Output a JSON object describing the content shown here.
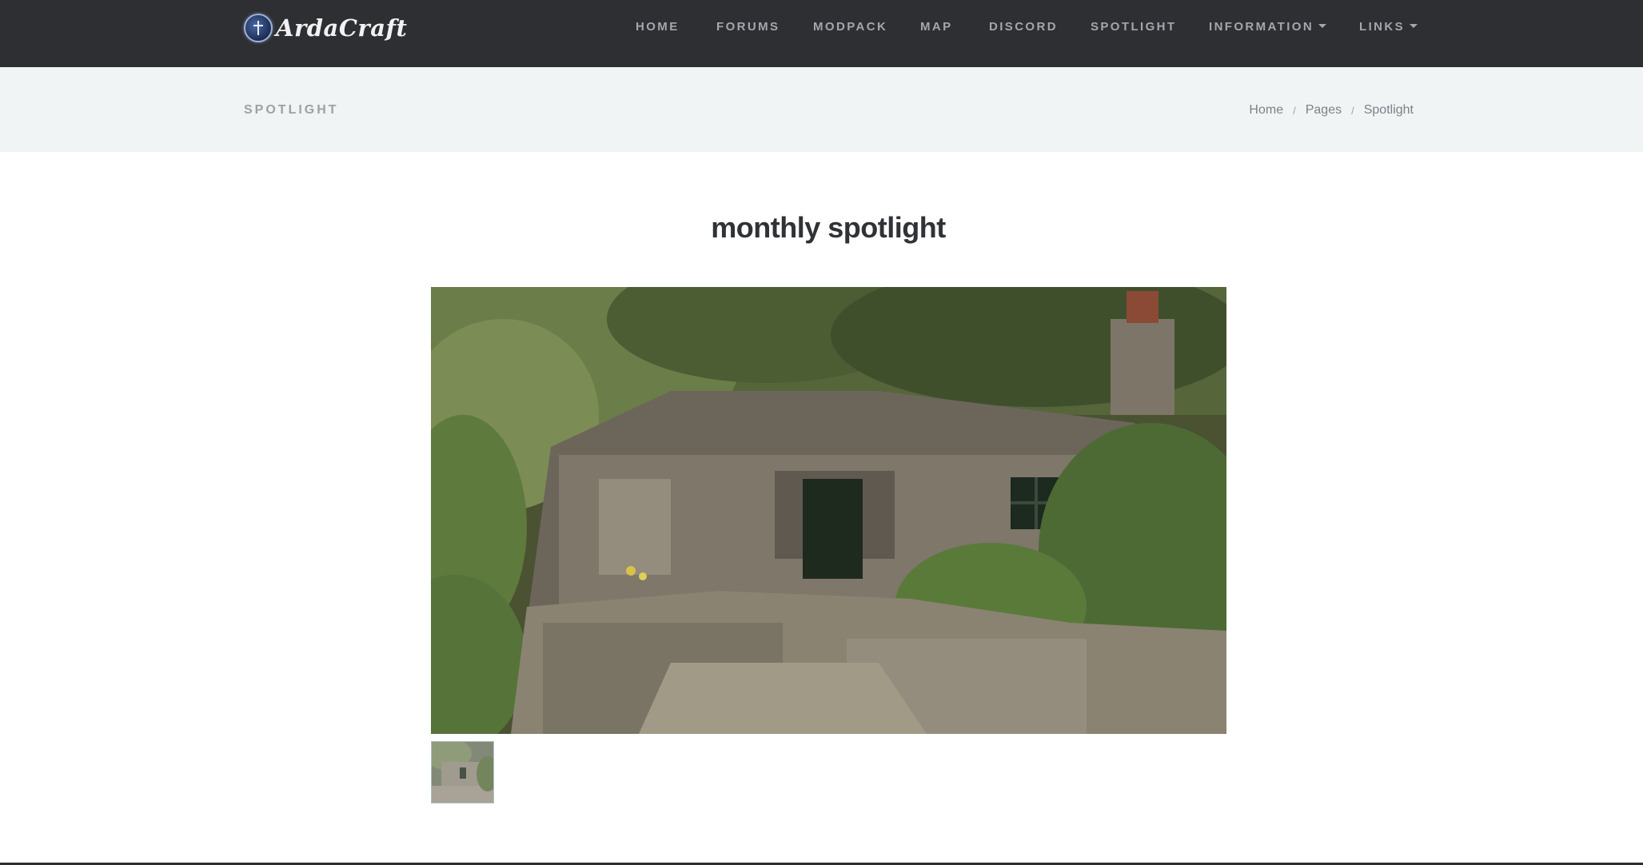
{
  "header": {
    "brand_name": "ArdaCraft",
    "nav": [
      {
        "label": "HOME",
        "dropdown": false
      },
      {
        "label": "FORUMS",
        "dropdown": false
      },
      {
        "label": "MODPACK",
        "dropdown": false
      },
      {
        "label": "MAP",
        "dropdown": false
      },
      {
        "label": "DISCORD",
        "dropdown": false
      },
      {
        "label": "SPOTLIGHT",
        "dropdown": false
      },
      {
        "label": "INFORMATION",
        "dropdown": true
      },
      {
        "label": "LINKS",
        "dropdown": true
      }
    ]
  },
  "subheader": {
    "page_label": "SPOTLIGHT",
    "breadcrumb": [
      "Home",
      "Pages",
      "Spotlight"
    ]
  },
  "main": {
    "title": "monthly spotlight"
  },
  "colors": {
    "navbar_bg": "#2d2f33",
    "nav_text": "#a3a7ad",
    "subheader_bg": "#f1f4f5",
    "title_text": "#2f3337"
  }
}
